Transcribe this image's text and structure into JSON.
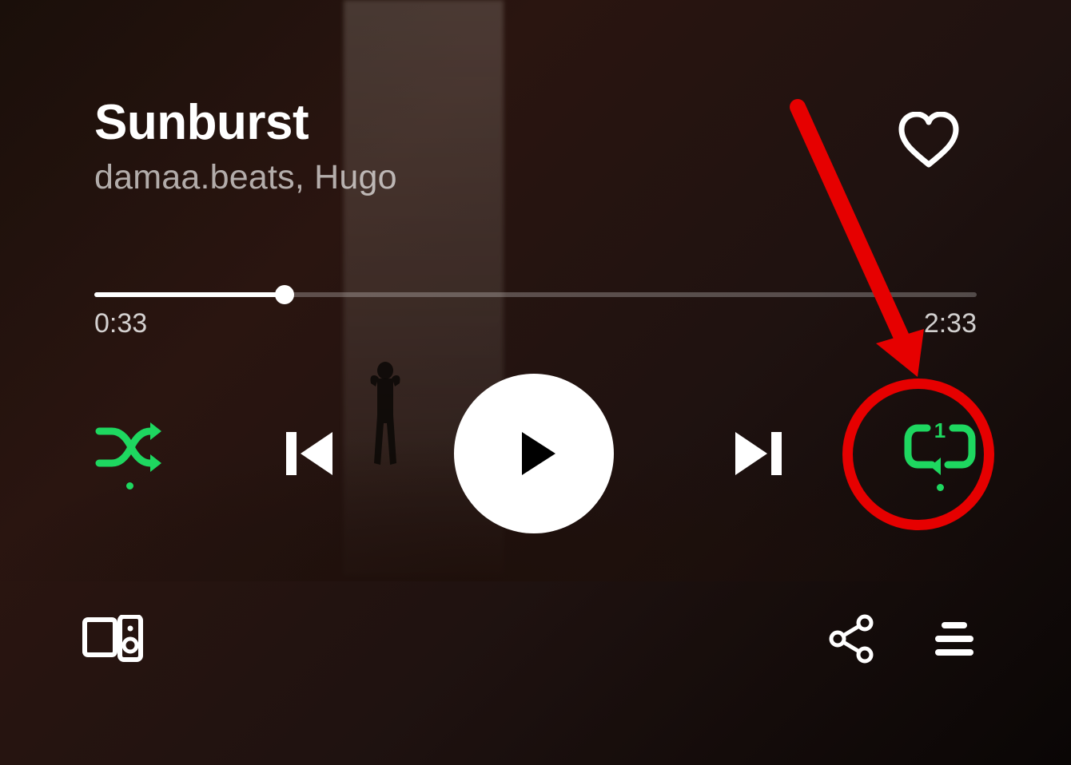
{
  "track": {
    "title": "Sunburst",
    "artist": "damaa.beats, Hugo"
  },
  "progress": {
    "elapsed": "0:33",
    "total": "2:33",
    "percent": 21.6
  },
  "colors": {
    "accent": "#1ed760",
    "annotation": "#e60000"
  },
  "state": {
    "shuffle_on": true,
    "repeat_mode": "one",
    "liked": false,
    "playing": false
  },
  "icons": {
    "heart": "heart-icon",
    "shuffle": "shuffle-icon",
    "previous": "previous-icon",
    "play": "play-icon",
    "next": "next-icon",
    "repeat_one": "repeat-one-icon",
    "devices": "devices-icon",
    "share": "share-icon",
    "queue": "queue-icon"
  }
}
